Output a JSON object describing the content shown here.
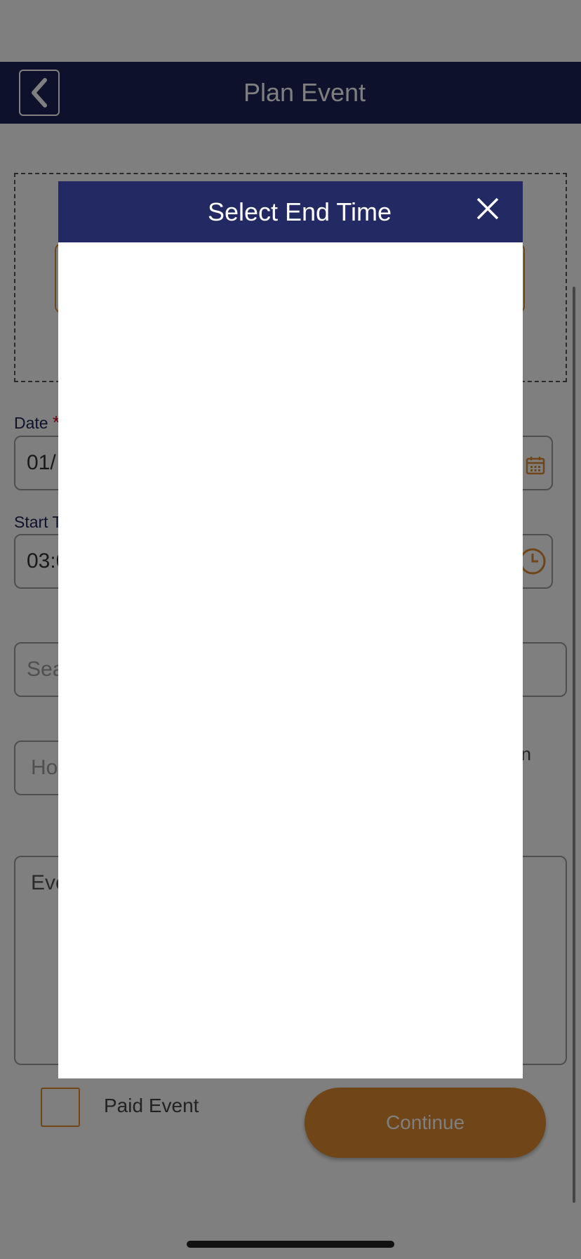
{
  "header": {
    "title": "Plan Event",
    "back_icon": "chevron-left-icon"
  },
  "form": {
    "date_label": "Date",
    "date_value": "01/",
    "start_label": "Start T",
    "start_value": "03:0",
    "search_placeholder": "Sea",
    "host_placeholder": "Ho",
    "side_text": "on",
    "description_placeholder": "Eve",
    "required_marker": "*",
    "calendar_icon": "calendar-icon",
    "clock_icon": "clock-icon"
  },
  "footer": {
    "paid_label": "Paid Event",
    "continue_label": "Continue"
  },
  "modal": {
    "title": "Select End Time",
    "close_icon": "close-icon"
  },
  "colors": {
    "navy": "#1d2356",
    "modal_header": "#232962",
    "accent": "#e08a2e",
    "required": "#d0021b"
  }
}
